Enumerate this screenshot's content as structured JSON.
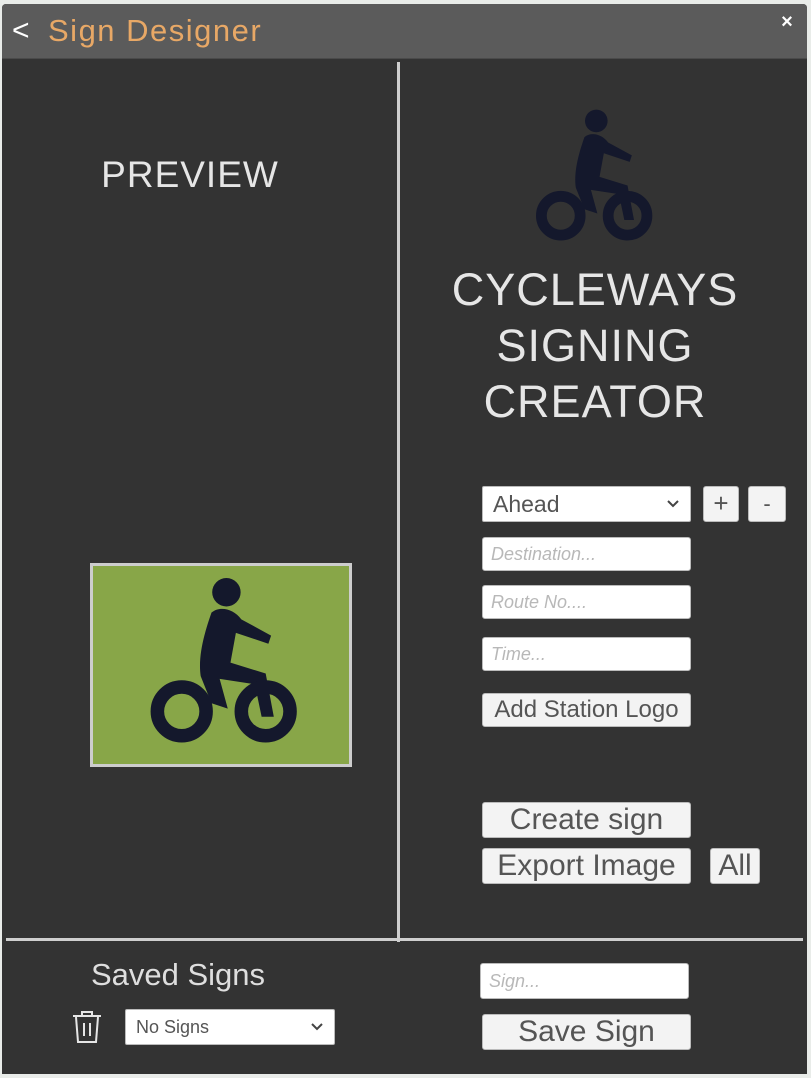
{
  "titlebar": {
    "back": "<",
    "title": "Sign Designer",
    "close": "×"
  },
  "preview": {
    "label": "PREVIEW",
    "sign_color": "#88a648"
  },
  "brand": {
    "line1": "CYCLEWAYS",
    "line2": "SIGNING",
    "line3": "CREATOR",
    "icon": "cyclist-icon",
    "icon_color": "#14182c"
  },
  "controls": {
    "direction": {
      "value": "Ahead"
    },
    "add_label": "+",
    "remove_label": "-",
    "destination_placeholder": "Destination...",
    "route_placeholder": "Route No....",
    "time_placeholder": "Time...",
    "add_logo_label": "Add Station Logo",
    "create_label": "Create sign",
    "export_label": "Export Image",
    "all_label": "All"
  },
  "saved": {
    "label": "Saved Signs",
    "select_value": "No Signs",
    "sign_placeholder": "Sign...",
    "save_label": "Save Sign"
  },
  "colors": {
    "title_accent": "#e8a866",
    "panel_bg": "#333333",
    "titlebar_bg": "#5b5b5b"
  }
}
